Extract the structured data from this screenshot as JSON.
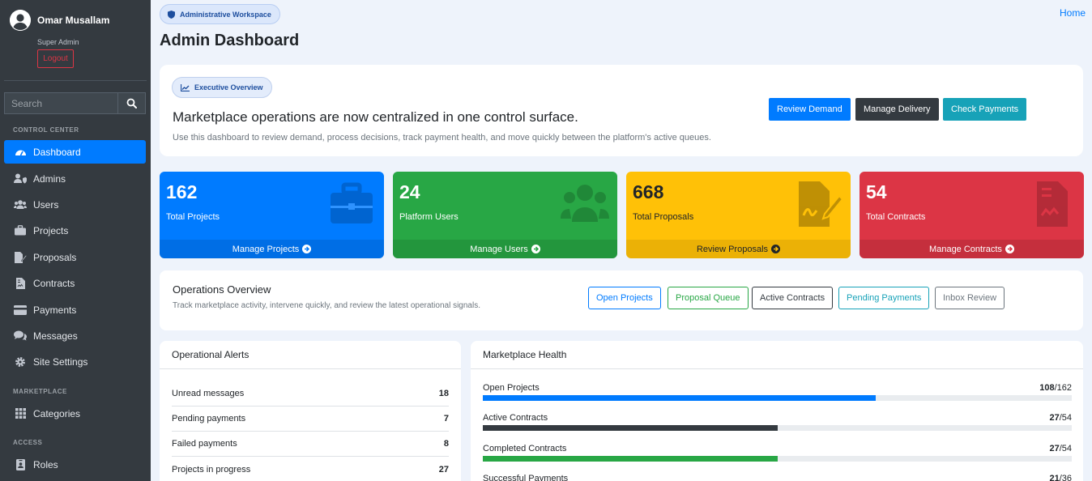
{
  "user": {
    "name": "Omar Musallam",
    "role": "Super Admin",
    "logout": "Logout"
  },
  "search": {
    "placeholder": "Search"
  },
  "nav": {
    "control_center": "CONTROL CENTER",
    "marketplace": "MARKETPLACE",
    "access": "ACCESS",
    "items": [
      {
        "label": "Dashboard",
        "icon": "dashboard-gauge-icon",
        "active": true
      },
      {
        "label": "Admins",
        "icon": "user-shield-icon"
      },
      {
        "label": "Users",
        "icon": "users-icon"
      },
      {
        "label": "Projects",
        "icon": "briefcase-icon"
      },
      {
        "label": "Proposals",
        "icon": "file-signature-icon"
      },
      {
        "label": "Contracts",
        "icon": "file-contract-icon"
      },
      {
        "label": "Payments",
        "icon": "credit-card-icon"
      },
      {
        "label": "Messages",
        "icon": "comments-icon"
      },
      {
        "label": "Site Settings",
        "icon": "gear-icon"
      },
      {
        "label": "Categories",
        "icon": "grid-icon"
      },
      {
        "label": "Roles",
        "icon": "id-badge-icon"
      }
    ]
  },
  "header": {
    "badge": "Administrative Workspace",
    "title": "Admin Dashboard",
    "home": "Home"
  },
  "hero": {
    "badge": "Executive Overview",
    "title": "Marketplace operations are now centralized in one control surface.",
    "subtitle": "Use this dashboard to review demand, process decisions, track payment health, and move quickly between the platform's active queues.",
    "buttons": [
      "Review Demand",
      "Manage Delivery",
      "Check Payments"
    ]
  },
  "stats": [
    {
      "value": "162",
      "label": "Total Projects",
      "link": "Manage Projects",
      "color": "#007bff",
      "icon": "briefcase-icon"
    },
    {
      "value": "24",
      "label": "Platform Users",
      "link": "Manage Users",
      "color": "#28a745",
      "icon": "users-icon"
    },
    {
      "value": "668",
      "label": "Total Proposals",
      "link": "Review Proposals",
      "color": "#ffc107",
      "icon": "file-signature-icon"
    },
    {
      "value": "54",
      "label": "Total Contracts",
      "link": "Manage Contracts",
      "color": "#dc3545",
      "icon": "file-contract-icon"
    }
  ],
  "ops": {
    "title": "Operations Overview",
    "subtitle": "Track marketplace activity, intervene quickly, and review the latest operational signals.",
    "buttons": [
      "Open Projects",
      "Proposal Queue",
      "Active Contracts",
      "Pending Payments",
      "Inbox Review"
    ]
  },
  "alerts": {
    "title": "Operational Alerts",
    "rows": [
      {
        "label": "Unread messages",
        "value": "18"
      },
      {
        "label": "Pending payments",
        "value": "7"
      },
      {
        "label": "Failed payments",
        "value": "8"
      },
      {
        "label": "Projects in progress",
        "value": "27"
      }
    ]
  },
  "health": {
    "title": "Marketplace Health",
    "rows": [
      {
        "label": "Open Projects",
        "num": "108",
        "den": "/162",
        "fraction": 0.667,
        "color": "#007bff"
      },
      {
        "label": "Active Contracts",
        "num": "27",
        "den": "/54",
        "fraction": 0.5,
        "color": "#343a40"
      },
      {
        "label": "Completed Contracts",
        "num": "27",
        "den": "/54",
        "fraction": 0.5,
        "color": "#28a745"
      },
      {
        "label": "Successful Payments",
        "num": "21",
        "den": "/36",
        "fraction": 0.583,
        "color": "#17a2b8"
      }
    ]
  }
}
